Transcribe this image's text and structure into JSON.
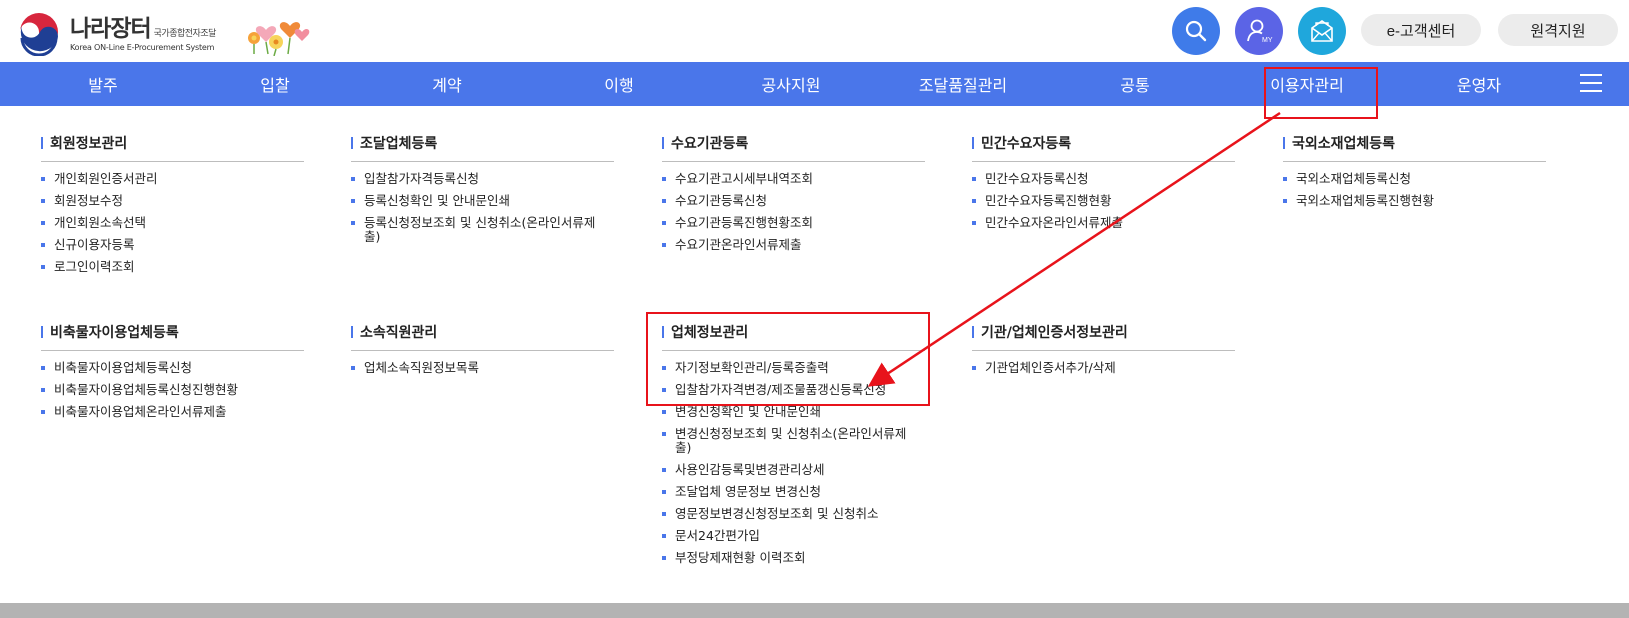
{
  "header": {
    "logo_name": "나라장터",
    "logo_sub": "국가종합전자조달",
    "logo_en": "Korea ON-Line E-Procurement System",
    "my_label": "MY",
    "customer_center": "e-고객센터",
    "remote_support": "원격지원"
  },
  "colors": {
    "accent": "#4a76ea",
    "annotation": "#e8131b"
  },
  "gnb": [
    "발주",
    "입찰",
    "계약",
    "이행",
    "공사지원",
    "조달품질관리",
    "공통",
    "이용자관리",
    "운영자"
  ],
  "groups": [
    {
      "title": "회원정보관리",
      "items": [
        "개인회원인증서관리",
        "회원정보수정",
        "개인회원소속선택",
        "신규이용자등록",
        "로그인이력조회"
      ]
    },
    {
      "title": "조달업체등록",
      "items": [
        "입찰참가자격등록신청",
        "등록신청확인 및 안내문인쇄",
        "등록신청정보조회 및 신청취소(온라인서류제",
        "출)"
      ]
    },
    {
      "title": "수요기관등록",
      "items": [
        "수요기관고시세부내역조회",
        "수요기관등록신청",
        "수요기관등록진행현황조회",
        "수요기관온라인서류제출"
      ]
    },
    {
      "title": "민간수요자등록",
      "items": [
        "민간수요자등록신청",
        "민간수요자등록진행현황",
        "민간수요자온라인서류제출"
      ]
    },
    {
      "title": "국외소재업체등록",
      "items": [
        "국외소재업체등록신청",
        "국외소재업체등록진행현황"
      ]
    },
    {
      "title": "비축물자이용업체등록",
      "items": [
        "비축물자이용업체등록신청",
        "비축물자이용업체등록신청진행현황",
        "비축물자이용업체온라인서류제출"
      ]
    },
    {
      "title": "소속직원관리",
      "items": [
        "업체소속직원정보목록"
      ]
    },
    {
      "title": "업체정보관리",
      "items": [
        "자기정보확인관리/등록증출력",
        "입찰참가자격변경/제조물품갱신등록신청",
        "변경신청확인 및 안내문인쇄",
        "변경신청정보조회 및 신청취소(온라인서류제",
        "출)",
        "사용인감등록및변경관리상세",
        "조달업체 영문정보 변경신청",
        "영문정보변경신청정보조회 및 신청취소",
        "문서24간편가입",
        "부정당제재현황 이력조회"
      ]
    },
    {
      "title": "기관/업체인증서정보관리",
      "items": [
        "기관업체인증서추가/삭제"
      ]
    }
  ]
}
